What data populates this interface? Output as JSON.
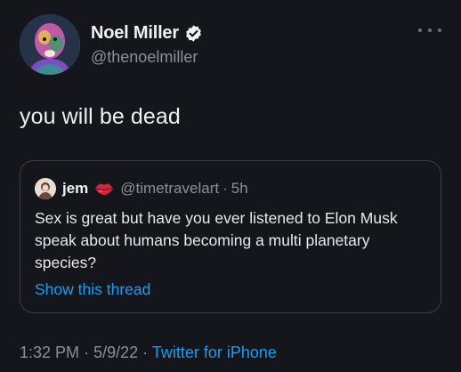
{
  "author": {
    "name": "Noel Miller",
    "handle": "@thenoelmiller",
    "verified": true
  },
  "tweet": {
    "text": "you will be dead"
  },
  "quoted_tweet": {
    "name": "jem",
    "handle": "@timetravelart",
    "time": "5h",
    "separator": "·",
    "text": "Sex is great but have you ever listened to Elon Musk speak about humans becoming a multi planetary species?",
    "show_thread_label": "Show this thread"
  },
  "meta": {
    "time": "1:32 PM",
    "date": "5/9/22",
    "separator": "·",
    "source": "Twitter for iPhone"
  },
  "icons": {
    "verified": "verified-badge-icon",
    "more": "more-options-icon",
    "name_emoji": "kiss-lips-icon"
  },
  "colors": {
    "background": "#15161b",
    "link": "#1d9bf0",
    "secondary_text": "#8b9097",
    "border": "#3a3e44"
  }
}
